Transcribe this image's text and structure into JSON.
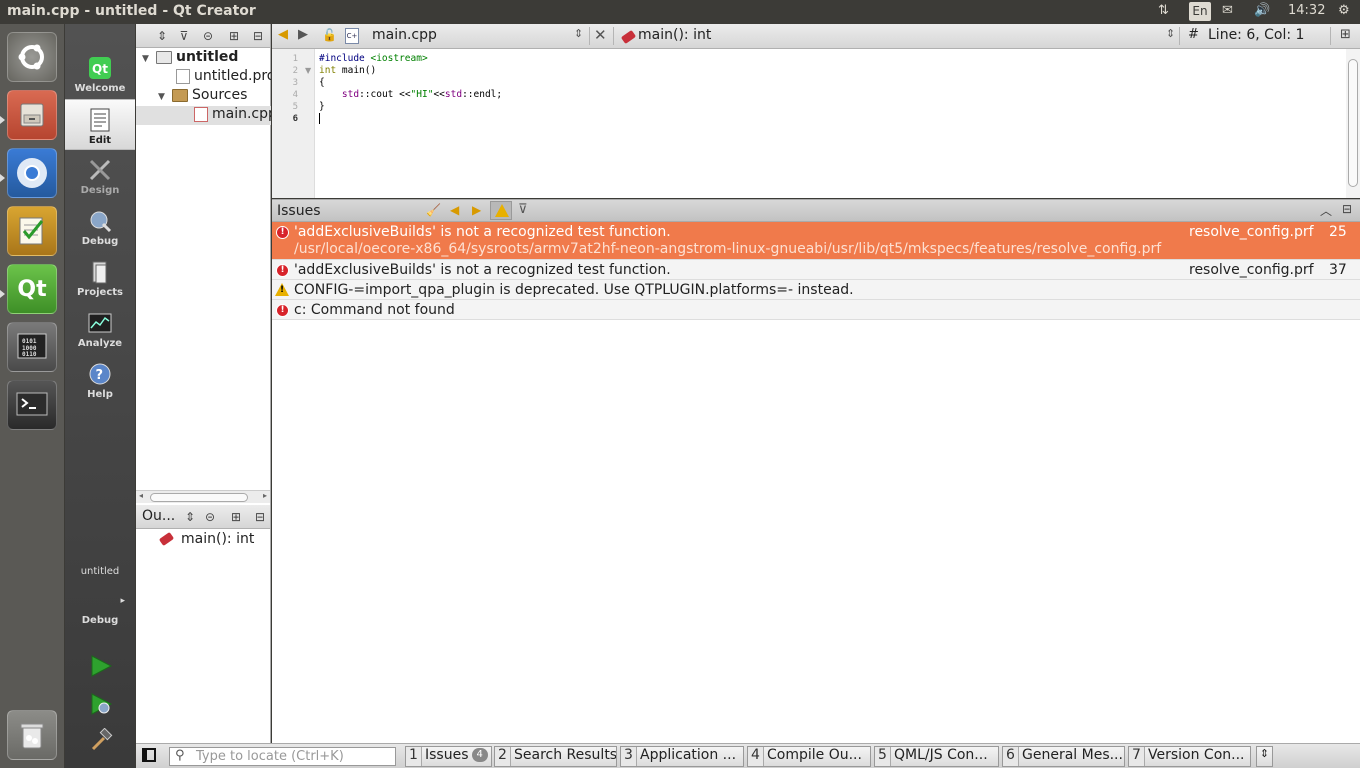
{
  "window": {
    "title": "main.cpp - untitled - Qt Creator"
  },
  "panel": {
    "language": "En",
    "time": "14:32"
  },
  "launcher": {
    "items": [
      {
        "name": "dash-home"
      },
      {
        "name": "files"
      },
      {
        "name": "chromium"
      },
      {
        "name": "text-editor"
      },
      {
        "name": "qt-creator"
      },
      {
        "name": "system-monitor"
      },
      {
        "name": "terminal"
      },
      {
        "name": "trash"
      }
    ]
  },
  "modes": {
    "welcome": "Welcome",
    "edit": "Edit",
    "design": "Design",
    "debug": "Debug",
    "projects": "Projects",
    "analyze": "Analyze",
    "help": "Help"
  },
  "kit": {
    "project": "untitled",
    "config": "Debug"
  },
  "tree": {
    "project": "untitled",
    "pro_file": "untitled.pro",
    "sources_folder": "Sources",
    "source_file": "main.cpp"
  },
  "outline": {
    "title": "Ou...",
    "item": "main(): int"
  },
  "editor": {
    "file_combo": "main.cpp",
    "symbol_combo": "main(): int",
    "position": "Line: 6, Col: 1",
    "hash": "#",
    "line_numbers": [
      "1",
      "2",
      "3",
      "4",
      "5",
      "6"
    ],
    "code": {
      "l1_pre": "#include ",
      "l1_inc": "<iostream>",
      "l2_type": "int",
      "l2_rest": " main()",
      "l3": "{",
      "l4_indent": "    ",
      "l4_ns1": "std",
      "l4_a": "::cout <<",
      "l4_str": "\"HI\"",
      "l4_b": "<<",
      "l4_ns2": "std",
      "l4_c": "::endl;",
      "l5": "}"
    }
  },
  "issues": {
    "title": "Issues",
    "rows": [
      {
        "type": "error",
        "message": "'addExclusiveBuilds' is not a recognized test function.",
        "path": "/usr/local/oecore-x86_64/sysroots/armv7at2hf-neon-angstrom-linux-gnueabi/usr/lib/qt5/mkspecs/features/resolve_config.prf",
        "file": "resolve_config.prf",
        "line": "25"
      },
      {
        "type": "error",
        "message": "'addExclusiveBuilds' is not a recognized test function.",
        "file": "resolve_config.prf",
        "line": "37"
      },
      {
        "type": "warning",
        "message": "CONFIG-=import_qpa_plugin is deprecated. Use QTPLUGIN.platforms=- instead."
      },
      {
        "type": "error",
        "message": "c: Command not found"
      }
    ]
  },
  "statusbar": {
    "locate_placeholder": "Type to locate (Ctrl+K)",
    "tabs": [
      {
        "num": "1",
        "label": "Issues",
        "badge": "4"
      },
      {
        "num": "2",
        "label": "Search Results"
      },
      {
        "num": "3",
        "label": "Application ..."
      },
      {
        "num": "4",
        "label": "Compile Ou..."
      },
      {
        "num": "5",
        "label": "QML/JS Con..."
      },
      {
        "num": "6",
        "label": "General Mes..."
      },
      {
        "num": "7",
        "label": "Version Con..."
      }
    ]
  },
  "colors": {
    "selected_issue": "#f07a4b",
    "error": "#d8232a",
    "warning": "#e8b000",
    "run_green": "#2ea12e"
  }
}
